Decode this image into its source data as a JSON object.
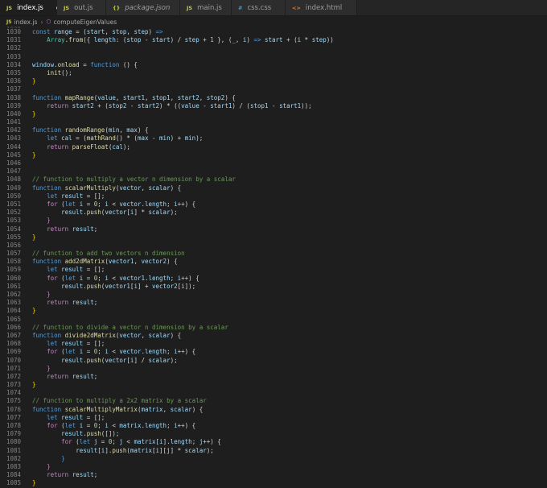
{
  "tabs": [
    {
      "label": "index.js",
      "icon": "JS",
      "active": true,
      "modified": true
    },
    {
      "label": "out.js",
      "icon": "JS"
    },
    {
      "label": "package.json",
      "icon": "{}"
    },
    {
      "label": "main.js",
      "icon": "JS"
    },
    {
      "label": "css.css",
      "icon": "#"
    },
    {
      "label": "index.html",
      "icon": "<>"
    }
  ],
  "breadcrumb": {
    "file": "index.js",
    "file_icon": "JS",
    "symbol": "computeEigenValues"
  },
  "code_lines": [
    {
      "n": "1030",
      "html": "<span class=\"k\">const</span> <span class=\"v\">range</span> = (<span class=\"v\">start</span>, <span class=\"v\">stop</span>, <span class=\"v\">step</span>) <span class=\"k\">=&gt;</span>"
    },
    {
      "n": "1031",
      "html": "    <span class=\"t\">Array</span>.<span class=\"f\">from</span>({ <span class=\"v\">length</span>: (<span class=\"v\">stop</span> - <span class=\"v\">start</span>) / <span class=\"v\">step</span> + <span class=\"n\">1</span> }, (<span class=\"v\">_</span>, <span class=\"v\">i</span>) <span class=\"k\">=&gt;</span> <span class=\"v\">start</span> + (<span class=\"v\">i</span> * <span class=\"v\">step</span>))"
    },
    {
      "n": "1032",
      "html": ""
    },
    {
      "n": "1033",
      "html": ""
    },
    {
      "n": "1034",
      "html": "<span class=\"v\">window</span>.<span class=\"f\">onload</span> = <span class=\"k\">function</span> () {"
    },
    {
      "n": "1035",
      "html": "    <span class=\"f\">init</span>();"
    },
    {
      "n": "1036",
      "html": "<span class=\"p\">}</span>"
    },
    {
      "n": "1037",
      "html": ""
    },
    {
      "n": "1038",
      "html": "<span class=\"k\">function</span> <span class=\"f\">mapRange</span>(<span class=\"v\">value</span>, <span class=\"v\">start1</span>, <span class=\"v\">stop1</span>, <span class=\"v\">start2</span>, <span class=\"v\">stop2</span>) {"
    },
    {
      "n": "1039",
      "html": "    <span class=\"c\">return</span> <span class=\"v\">start2</span> + (<span class=\"v\">stop2</span> - <span class=\"v\">start2</span>) * ((<span class=\"v\">value</span> - <span class=\"v\">start1</span>) / (<span class=\"v\">stop1</span> - <span class=\"v\">start1</span>));"
    },
    {
      "n": "1040",
      "html": "<span class=\"p\">}</span>"
    },
    {
      "n": "1041",
      "html": ""
    },
    {
      "n": "1042",
      "html": "<span class=\"k\">function</span> <span class=\"f\">randomRange</span>(<span class=\"v\">min</span>, <span class=\"v\">max</span>) {"
    },
    {
      "n": "1043",
      "html": "    <span class=\"k\">let</span> <span class=\"v\">cal</span> = (<span class=\"f\">mathRand</span>() * (<span class=\"v\">max</span> - <span class=\"v\">min</span>) + <span class=\"v\">min</span>);"
    },
    {
      "n": "1044",
      "html": "    <span class=\"c\">return</span> <span class=\"f\">parseFloat</span>(<span class=\"v\">cal</span>);"
    },
    {
      "n": "1045",
      "html": "<span class=\"p\">}</span>"
    },
    {
      "n": "1046",
      "html": ""
    },
    {
      "n": "1047",
      "html": ""
    },
    {
      "n": "1048",
      "html": "<span class=\"cm\">// function to multiply a vector n dimension by a scalar</span>"
    },
    {
      "n": "1049",
      "html": "<span class=\"k\">function</span> <span class=\"f\">scalarMultiply</span>(<span class=\"v\">vector</span>, <span class=\"v\">scalar</span>) {"
    },
    {
      "n": "1050",
      "html": "    <span class=\"k\">let</span> <span class=\"v\">result</span> = [];"
    },
    {
      "n": "1051",
      "html": "    <span class=\"c\">for</span> (<span class=\"k\">let</span> <span class=\"v\">i</span> = <span class=\"n\">0</span>; <span class=\"v\">i</span> &lt; <span class=\"v\">vector</span>.<span class=\"v\">length</span>; <span class=\"v\">i</span>++) {"
    },
    {
      "n": "1052",
      "html": "        <span class=\"v\">result</span>.<span class=\"f\">push</span>(<span class=\"v\">vector</span>[<span class=\"v\">i</span>] * <span class=\"v\">scalar</span>);"
    },
    {
      "n": "1053",
      "html": "    <span class=\"c\">}</span>"
    },
    {
      "n": "1054",
      "html": "    <span class=\"c\">return</span> <span class=\"v\">result</span>;"
    },
    {
      "n": "1055",
      "html": "<span class=\"p\">}</span>"
    },
    {
      "n": "1056",
      "html": ""
    },
    {
      "n": "1057",
      "html": "<span class=\"cm\">// function to add two vectors n dimension</span>"
    },
    {
      "n": "1058",
      "html": "<span class=\"k\">function</span> <span class=\"f\">add2dMatrix</span>(<span class=\"v\">vector1</span>, <span class=\"v\">vector2</span>) {"
    },
    {
      "n": "1059",
      "html": "    <span class=\"k\">let</span> <span class=\"v\">result</span> = [];"
    },
    {
      "n": "1060",
      "html": "    <span class=\"c\">for</span> (<span class=\"k\">let</span> <span class=\"v\">i</span> = <span class=\"n\">0</span>; <span class=\"v\">i</span> &lt; <span class=\"v\">vector1</span>.<span class=\"v\">length</span>; <span class=\"v\">i</span>++) {"
    },
    {
      "n": "1061",
      "html": "        <span class=\"v\">result</span>.<span class=\"f\">push</span>(<span class=\"v\">vector1</span>[<span class=\"v\">i</span>] + <span class=\"v\">vector2</span>[<span class=\"v\">i</span>]);"
    },
    {
      "n": "1062",
      "html": "    <span class=\"c\">}</span>"
    },
    {
      "n": "1063",
      "html": "    <span class=\"c\">return</span> <span class=\"v\">result</span>;"
    },
    {
      "n": "1064",
      "html": "<span class=\"p\">}</span>"
    },
    {
      "n": "1065",
      "html": ""
    },
    {
      "n": "1066",
      "html": "<span class=\"cm\">// function to divide a vector n dimension by a scalar</span>"
    },
    {
      "n": "1067",
      "html": "<span class=\"k\">function</span> <span class=\"f\">divide2dMatrix</span>(<span class=\"v\">vector</span>, <span class=\"v\">scalar</span>) {"
    },
    {
      "n": "1068",
      "html": "    <span class=\"k\">let</span> <span class=\"v\">result</span> = [];"
    },
    {
      "n": "1069",
      "html": "    <span class=\"c\">for</span> (<span class=\"k\">let</span> <span class=\"v\">i</span> = <span class=\"n\">0</span>; <span class=\"v\">i</span> &lt; <span class=\"v\">vector</span>.<span class=\"v\">length</span>; <span class=\"v\">i</span>++) {"
    },
    {
      "n": "1070",
      "html": "        <span class=\"v\">result</span>.<span class=\"f\">push</span>(<span class=\"v\">vector</span>[<span class=\"v\">i</span>] / <span class=\"v\">scalar</span>);"
    },
    {
      "n": "1071",
      "html": "    <span class=\"c\">}</span>"
    },
    {
      "n": "1072",
      "html": "    <span class=\"c\">return</span> <span class=\"v\">result</span>;"
    },
    {
      "n": "1073",
      "html": "<span class=\"p\">}</span>"
    },
    {
      "n": "1074",
      "html": ""
    },
    {
      "n": "1075",
      "html": "<span class=\"cm\">// function to multiply a 2x2 matrix by a scalar</span>"
    },
    {
      "n": "1076",
      "html": "<span class=\"k\">function</span> <span class=\"f\">scalarMultiplyMatrix</span>(<span class=\"v\">matrix</span>, <span class=\"v\">scalar</span>) {"
    },
    {
      "n": "1077",
      "html": "    <span class=\"k\">let</span> <span class=\"v\">result</span> = [];"
    },
    {
      "n": "1078",
      "html": "    <span class=\"c\">for</span> (<span class=\"k\">let</span> <span class=\"v\">i</span> = <span class=\"n\">0</span>; <span class=\"v\">i</span> &lt; <span class=\"v\">matrix</span>.<span class=\"v\">length</span>; <span class=\"v\">i</span>++) {"
    },
    {
      "n": "1079",
      "html": "        <span class=\"v\">result</span>.<span class=\"f\">push</span>([]);"
    },
    {
      "n": "1080",
      "html": "        <span class=\"c\">for</span> (<span class=\"k\">let</span> <span class=\"v\">j</span> = <span class=\"n\">0</span>; <span class=\"v\">j</span> &lt; <span class=\"v\">matrix</span>[<span class=\"v\">i</span>].<span class=\"v\">length</span>; <span class=\"v\">j</span>++) {"
    },
    {
      "n": "1081",
      "html": "            <span class=\"v\">result</span>[<span class=\"v\">i</span>].<span class=\"f\">push</span>(<span class=\"v\">matrix</span>[<span class=\"v\">i</span>][<span class=\"v\">j</span>] * <span class=\"v\">scalar</span>);"
    },
    {
      "n": "1082",
      "html": "        <span class=\"k\">}</span>"
    },
    {
      "n": "1083",
      "html": "    <span class=\"c\">}</span>"
    },
    {
      "n": "1084",
      "html": "    <span class=\"c\">return</span> <span class=\"v\">result</span>;"
    },
    {
      "n": "1085",
      "html": "<span class=\"p\">}</span>"
    }
  ]
}
